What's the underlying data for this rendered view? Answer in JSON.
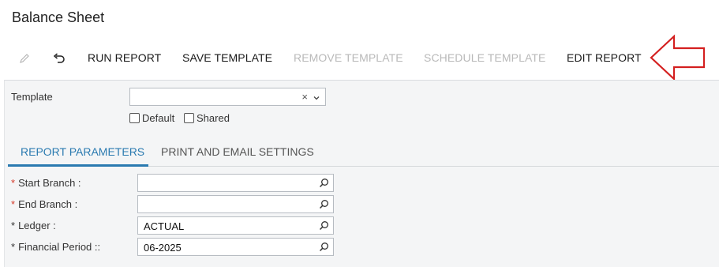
{
  "page": {
    "title": "Balance Sheet"
  },
  "toolbar": {
    "edit_icon": "pencil-icon",
    "undo_icon": "undo-icon",
    "run_report": "RUN REPORT",
    "save_template": "SAVE TEMPLATE",
    "remove_template": "REMOVE TEMPLATE",
    "schedule_template": "SCHEDULE TEMPLATE",
    "edit_report": "EDIT REPORT"
  },
  "annotation": {
    "icon": "arrow-left-outline-icon",
    "color": "#d42020"
  },
  "template": {
    "label": "Template",
    "value": "",
    "clear_glyph": "×",
    "default_label": "Default",
    "default_checked": false,
    "shared_label": "Shared",
    "shared_checked": false
  },
  "tabs": [
    {
      "label": "REPORT PARAMETERS",
      "active": true
    },
    {
      "label": "PRINT AND EMAIL SETTINGS",
      "active": false
    }
  ],
  "parameters": [
    {
      "marker": "*",
      "label": "Start Branch :",
      "value": "",
      "required_color": "#d43a2a"
    },
    {
      "marker": "*",
      "label": "End Branch :",
      "value": "",
      "required_color": "#d43a2a"
    },
    {
      "marker": "*",
      "label": "Ledger :",
      "value": "ACTUAL",
      "required_color": "#333333"
    },
    {
      "marker": "*",
      "label": "Financial Period ::",
      "value": "06-2025",
      "required_color": "#333333"
    }
  ],
  "colors": {
    "accent": "#2a7ab0",
    "disabled": "#b9b9b9",
    "required": "#d43a2a"
  }
}
